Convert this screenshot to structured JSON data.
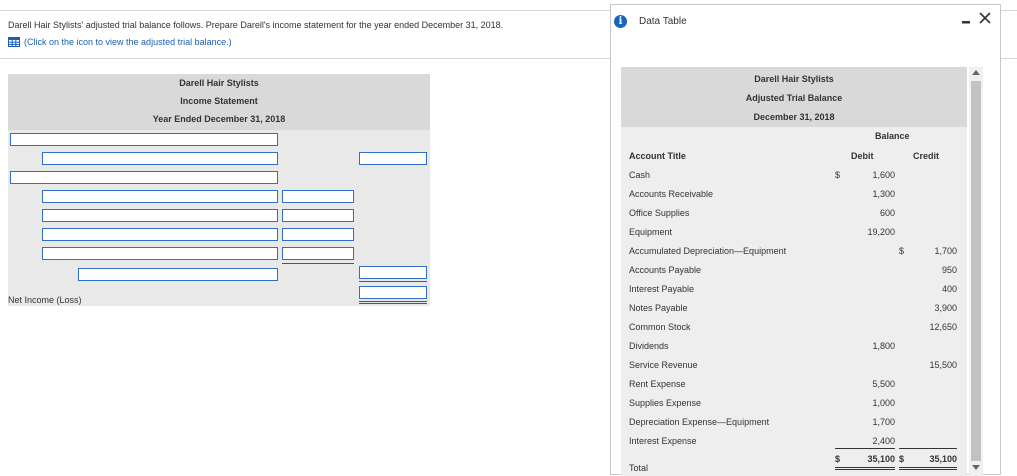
{
  "question": {
    "prompt": "Darell Hair Stylists' adjusted trial balance follows. Prepare Darell's income statement for the year ended December 31, 2018.",
    "hint": "(Click on the icon to view the adjusted trial balance.)",
    "hint_icon": "table-grid-icon"
  },
  "statement": {
    "company": "Darell Hair Stylists",
    "title": "Income Statement",
    "period": "Year Ended December 31, 2018",
    "net_income_label": "Net Income (Loss)"
  },
  "dialog": {
    "title": "Data Table",
    "info_icon": "info-icon",
    "minimize_label": "–",
    "close_label": "✕"
  },
  "trial_balance": {
    "company": "Darell Hair Stylists",
    "title": "Adjusted Trial Balance",
    "date": "December 31, 2018",
    "balance_header": "Balance",
    "col_account": "Account Title",
    "col_debit": "Debit",
    "col_credit": "Credit",
    "rows": [
      {
        "account": "Cash",
        "debit_sign": "$",
        "debit": "1,600",
        "credit_sign": "",
        "credit": ""
      },
      {
        "account": "Accounts Receivable",
        "debit_sign": "",
        "debit": "1,300",
        "credit_sign": "",
        "credit": ""
      },
      {
        "account": "Office Supplies",
        "debit_sign": "",
        "debit": "600",
        "credit_sign": "",
        "credit": ""
      },
      {
        "account": "Equipment",
        "debit_sign": "",
        "debit": "19,200",
        "credit_sign": "",
        "credit": ""
      },
      {
        "account": "Accumulated Depreciation—Equipment",
        "debit_sign": "",
        "debit": "",
        "credit_sign": "$",
        "credit": "1,700"
      },
      {
        "account": "Accounts Payable",
        "debit_sign": "",
        "debit": "",
        "credit_sign": "",
        "credit": "950"
      },
      {
        "account": "Interest Payable",
        "debit_sign": "",
        "debit": "",
        "credit_sign": "",
        "credit": "400"
      },
      {
        "account": "Notes Payable",
        "debit_sign": "",
        "debit": "",
        "credit_sign": "",
        "credit": "3,900"
      },
      {
        "account": "Common Stock",
        "debit_sign": "",
        "debit": "",
        "credit_sign": "",
        "credit": "12,650"
      },
      {
        "account": "Dividends",
        "debit_sign": "",
        "debit": "1,800",
        "credit_sign": "",
        "credit": ""
      },
      {
        "account": "Service Revenue",
        "debit_sign": "",
        "debit": "",
        "credit_sign": "",
        "credit": "15,500"
      },
      {
        "account": "Rent Expense",
        "debit_sign": "",
        "debit": "5,500",
        "credit_sign": "",
        "credit": ""
      },
      {
        "account": "Supplies Expense",
        "debit_sign": "",
        "debit": "1,000",
        "credit_sign": "",
        "credit": ""
      },
      {
        "account": "Depreciation Expense—Equipment",
        "debit_sign": "",
        "debit": "1,700",
        "credit_sign": "",
        "credit": ""
      },
      {
        "account": "Interest Expense",
        "debit_sign": "",
        "debit": "2,400",
        "credit_sign": "",
        "credit": ""
      }
    ],
    "total": {
      "account": "Total",
      "debit_sign": "$",
      "debit": "35,100",
      "credit_sign": "$",
      "credit": "35,100"
    }
  }
}
